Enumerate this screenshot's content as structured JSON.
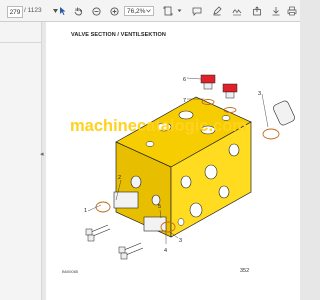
{
  "toolbar": {
    "current_page": "279",
    "total_pages": "/ 1123",
    "zoom": "76,2%"
  },
  "page": {
    "title": "VALVE SECTION / VENTILSEKTION",
    "drawing_code": "B600085",
    "page_number": "352"
  },
  "diagram": {
    "callouts": [
      "6",
      "7",
      "3",
      "2",
      "1",
      "5",
      "4",
      "3"
    ],
    "accent_color": "#f0c400",
    "plug_color": "#e0202a"
  },
  "watermark": "machinecatalogic.com"
}
